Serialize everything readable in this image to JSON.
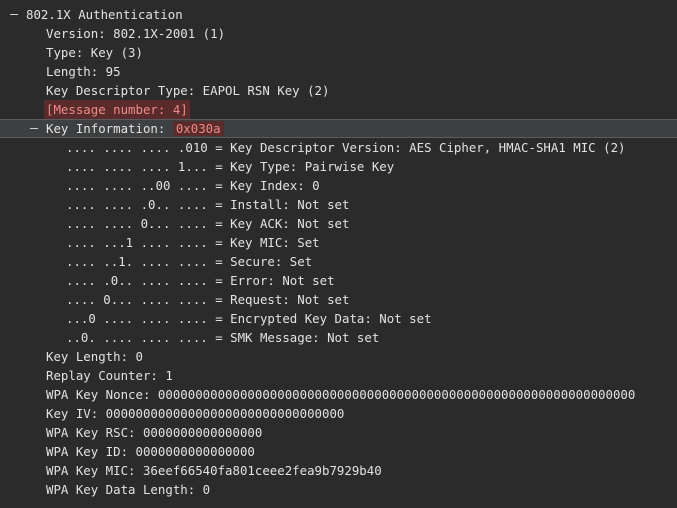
{
  "tree": {
    "eapol_header": "802.1X Authentication",
    "version": "Version: 802.1X-2001 (1)",
    "type": "Type: Key (3)",
    "length": "Length: 95",
    "key_descriptor_type": "Key Descriptor Type: EAPOL RSN Key (2)",
    "message_number": "[Message number: 4]",
    "key_information": {
      "label": "Key Information: ",
      "value": "0x030a",
      "bits": [
        ".... .... .... .010 = Key Descriptor Version: AES Cipher, HMAC-SHA1 MIC (2)",
        ".... .... .... 1... = Key Type: Pairwise Key",
        ".... .... ..00 .... = Key Index: 0",
        ".... .... .0.. .... = Install: Not set",
        ".... .... 0... .... = Key ACK: Not set",
        ".... ...1 .... .... = Key MIC: Set",
        ".... ..1. .... .... = Secure: Set",
        ".... .0.. .... .... = Error: Not set",
        ".... 0... .... .... = Request: Not set",
        "...0 .... .... .... = Encrypted Key Data: Not set",
        "..0. .... .... .... = SMK Message: Not set"
      ]
    },
    "key_length": "Key Length: 0",
    "replay_counter": "Replay Counter: 1",
    "wpa_key_nonce": "WPA Key Nonce: 0000000000000000000000000000000000000000000000000000000000000000",
    "wpa_key_iv": "Key IV: 00000000000000000000000000000000",
    "wpa_key_rsc": "WPA Key RSC: 0000000000000000",
    "wpa_key_id": "WPA Key ID: 0000000000000000",
    "wpa_key_mic": "WPA Key MIC: 36eef66540fa801ceee2fea9b7929b40",
    "wpa_key_data_length": "WPA Key Data Length: 0"
  },
  "colors": {
    "background": "#2b2b2b",
    "text": "#e2e2e2",
    "expert_info_bg": "#5a2b2b",
    "expert_info_text": "#ef8a8a",
    "selected_row_bg": "#3e3f41"
  },
  "icons": {
    "collapse": "collapse-toggle-icon",
    "parent_expand": "chevron-icon"
  }
}
